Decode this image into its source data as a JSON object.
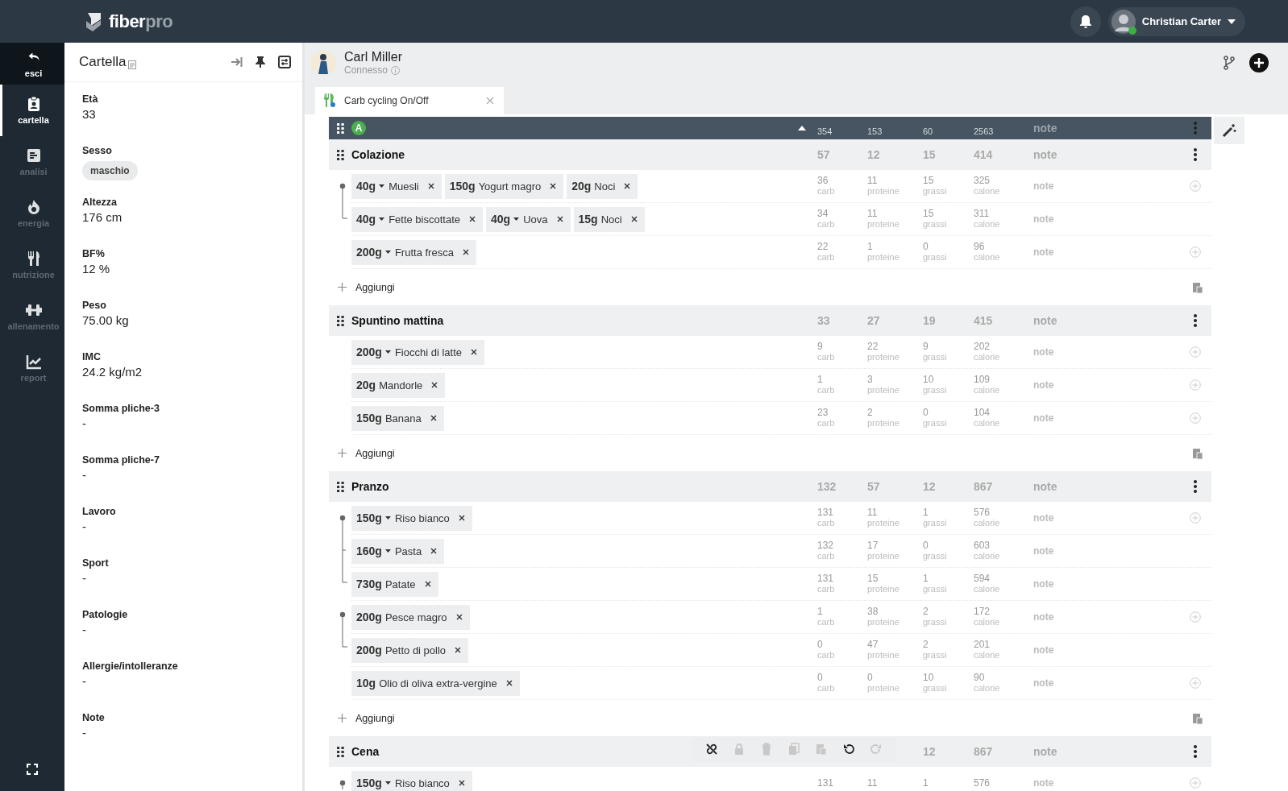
{
  "logo": {
    "primary": "fiber",
    "secondary": "pro"
  },
  "user": {
    "name": "Christian Carter",
    "online": true
  },
  "nav": {
    "items": [
      {
        "label": "esci",
        "kind": "back",
        "selected": false
      },
      {
        "label": "cartella",
        "kind": "link",
        "selected": true
      },
      {
        "label": "analisi",
        "kind": "link",
        "selected": false
      },
      {
        "label": "energia",
        "kind": "link",
        "selected": false
      },
      {
        "label": "nutrizione",
        "kind": "link",
        "selected": false
      },
      {
        "label": "allenamento",
        "kind": "link",
        "selected": false
      },
      {
        "label": "report",
        "kind": "link",
        "selected": false
      }
    ]
  },
  "record": {
    "title": "Cartella",
    "fields": [
      {
        "label": "Età",
        "value": "33",
        "kind": "text"
      },
      {
        "label": "Sesso",
        "value": "maschio",
        "kind": "chip"
      },
      {
        "label": "Altezza",
        "value": "176 cm",
        "kind": "text"
      },
      {
        "label": "BF%",
        "value": "12 %",
        "kind": "text"
      },
      {
        "label": "Peso",
        "value": "75.00 kg",
        "kind": "text"
      },
      {
        "label": "IMC",
        "value": "24.2 kg/m2",
        "kind": "text"
      },
      {
        "label": "Somma pliche-3",
        "value": "-",
        "kind": "text"
      },
      {
        "label": "Somma pliche-7",
        "value": "-",
        "kind": "text"
      },
      {
        "label": "Lavoro",
        "value": "-",
        "kind": "text"
      },
      {
        "label": "Sport",
        "value": "-",
        "kind": "text"
      },
      {
        "label": "Patologie",
        "value": "-",
        "kind": "text"
      },
      {
        "label": "Allergie/intolleranze",
        "value": "-",
        "kind": "text"
      },
      {
        "label": "Note",
        "value": "-",
        "kind": "text"
      }
    ]
  },
  "patient": {
    "name": "Carl Miller",
    "status": "Connesso"
  },
  "tabs": [
    {
      "label": "Carb cycling On/Off",
      "selected": true
    }
  ],
  "plan": {
    "badge": "A",
    "expanded": true,
    "summary": [
      "354",
      "153",
      "60",
      "2563"
    ],
    "summary_note": "note",
    "meals": [
      {
        "name": "Colazione",
        "totals": {
          "carb": "57",
          "proteine": "12",
          "grassi": "15",
          "calorie": "414"
        },
        "note": "note",
        "add_label": "Aggiungi",
        "rows": [
          {
            "kind": "start",
            "items": [
              {
                "qty": "40g",
                "dropdown": true,
                "name": "Muesli"
              },
              {
                "qty": "150g",
                "dropdown": false,
                "name": "Yogurt magro"
              },
              {
                "qty": "20g",
                "dropdown": false,
                "name": "Noci"
              }
            ],
            "values": [
              "36",
              "11",
              "15",
              "325"
            ],
            "units": [
              "carb",
              "proteine",
              "grassi",
              "calorie"
            ],
            "note": "note"
          },
          {
            "kind": "end",
            "items": [
              {
                "qty": "40g",
                "dropdown": true,
                "name": "Fette biscottate"
              },
              {
                "qty": "40g",
                "dropdown": true,
                "name": "Uova"
              },
              {
                "qty": "15g",
                "dropdown": false,
                "name": "Noci"
              }
            ],
            "values": [
              "34",
              "11",
              "15",
              "311"
            ],
            "units": [
              "carb",
              "proteine",
              "grassi",
              "calorie"
            ],
            "note": "note"
          },
          {
            "kind": "none",
            "items": [
              {
                "qty": "200g",
                "dropdown": true,
                "name": "Frutta fresca"
              }
            ],
            "values": [
              "22",
              "1",
              "0",
              "96"
            ],
            "units": [
              "carb",
              "proteine",
              "grassi",
              "calorie"
            ],
            "note": "note"
          }
        ]
      },
      {
        "name": "Spuntino mattina",
        "totals": {
          "carb": "33",
          "proteine": "27",
          "grassi": "19",
          "calorie": "415"
        },
        "note": "note",
        "add_label": "Aggiungi",
        "rows": [
          {
            "kind": "none",
            "items": [
              {
                "qty": "200g",
                "dropdown": true,
                "name": "Fiocchi di latte"
              }
            ],
            "values": [
              "9",
              "22",
              "9",
              "202"
            ],
            "units": [
              "carb",
              "proteine",
              "grassi",
              "calorie"
            ],
            "note": "note"
          },
          {
            "kind": "none",
            "items": [
              {
                "qty": "20g",
                "dropdown": false,
                "name": "Mandorle"
              }
            ],
            "values": [
              "1",
              "3",
              "10",
              "109"
            ],
            "units": [
              "carb",
              "proteine",
              "grassi",
              "calorie"
            ],
            "note": "note"
          },
          {
            "kind": "none",
            "items": [
              {
                "qty": "150g",
                "dropdown": false,
                "name": "Banana"
              }
            ],
            "values": [
              "23",
              "2",
              "0",
              "104"
            ],
            "units": [
              "carb",
              "proteine",
              "grassi",
              "calorie"
            ],
            "note": "note"
          }
        ]
      },
      {
        "name": "Pranzo",
        "totals": {
          "carb": "132",
          "proteine": "57",
          "grassi": "12",
          "calorie": "867"
        },
        "note": "note",
        "add_label": "Aggiungi",
        "rows": [
          {
            "kind": "start",
            "items": [
              {
                "qty": "150g",
                "dropdown": true,
                "name": "Riso bianco"
              }
            ],
            "values": [
              "131",
              "11",
              "1",
              "576"
            ],
            "units": [
              "carb",
              "proteine",
              "grassi",
              "calorie"
            ],
            "note": "note"
          },
          {
            "kind": "mid",
            "items": [
              {
                "qty": "160g",
                "dropdown": true,
                "name": "Pasta"
              }
            ],
            "values": [
              "132",
              "17",
              "0",
              "603"
            ],
            "units": [
              "carb",
              "proteine",
              "grassi",
              "calorie"
            ],
            "note": "note"
          },
          {
            "kind": "end",
            "items": [
              {
                "qty": "730g",
                "dropdown": false,
                "name": "Patate"
              }
            ],
            "values": [
              "131",
              "15",
              "1",
              "594"
            ],
            "units": [
              "carb",
              "proteine",
              "grassi",
              "calorie"
            ],
            "note": "note"
          },
          {
            "kind": "start",
            "items": [
              {
                "qty": "200g",
                "dropdown": false,
                "name": "Pesce magro"
              }
            ],
            "values": [
              "1",
              "38",
              "2",
              "172"
            ],
            "units": [
              "carb",
              "proteine",
              "grassi",
              "calorie"
            ],
            "note": "note"
          },
          {
            "kind": "end",
            "items": [
              {
                "qty": "200g",
                "dropdown": false,
                "name": "Petto di pollo"
              }
            ],
            "values": [
              "0",
              "47",
              "2",
              "201"
            ],
            "units": [
              "carb",
              "proteine",
              "grassi",
              "calorie"
            ],
            "note": "note"
          },
          {
            "kind": "none",
            "items": [
              {
                "qty": "10g",
                "dropdown": false,
                "name": "Olio di oliva extra-vergine"
              }
            ],
            "values": [
              "0",
              "0",
              "10",
              "90"
            ],
            "units": [
              "carb",
              "proteine",
              "grassi",
              "calorie"
            ],
            "note": "note"
          }
        ]
      },
      {
        "name": "Cena",
        "totals": {
          "grassi": "12",
          "calorie": "867"
        },
        "note": "note",
        "rows": [
          {
            "kind": "start",
            "items": [
              {
                "qty": "150g",
                "dropdown": true,
                "name": "Riso bianco"
              }
            ],
            "values": [
              "131",
              "11",
              "1",
              "576"
            ],
            "note": "note"
          }
        ]
      }
    ]
  },
  "toolbar": [
    {
      "kind": "unlink",
      "disabled": false
    },
    {
      "kind": "lock",
      "disabled": true
    },
    {
      "kind": "trash",
      "disabled": true
    },
    {
      "kind": "copy",
      "disabled": true
    },
    {
      "kind": "paste",
      "disabled": true
    },
    {
      "kind": "undo",
      "disabled": false
    },
    {
      "kind": "redo",
      "disabled": true
    }
  ]
}
